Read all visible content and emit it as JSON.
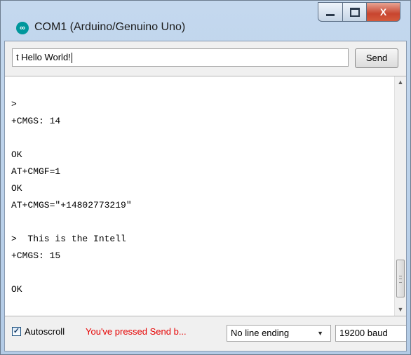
{
  "window": {
    "title": "COM1 (Arduino/Genuino Uno)",
    "app_icon": "arduino-logo-icon",
    "icon_glyph": "∞",
    "controls": [
      "minimize-icon",
      "maximize-icon",
      "close-icon"
    ],
    "close_glyph": "X"
  },
  "send_bar": {
    "input_value": "t Hello World!",
    "send_label": "Send"
  },
  "output": {
    "lines": [
      "",
      ">",
      "+CMGS: 14",
      "",
      "OK",
      "AT+CMGF=1",
      "OK",
      "AT+CMGS=\"+14802773219\"",
      "",
      ">  This is the Intell",
      "+CMGS: 15",
      "",
      "OK"
    ],
    "scroll_up": "▲",
    "scroll_down": "▼"
  },
  "status": {
    "autoscroll_checked": true,
    "check_glyph": "✓",
    "autoscroll_label": "Autoscroll",
    "warning": "You've pressed Send b...",
    "line_ending": "No line ending",
    "baud": "19200 baud",
    "dropdown_glyph": "▼"
  },
  "colors": {
    "warning_text": "#e60000",
    "title_bar": "#b9d0ea",
    "close_button": "#c8452f",
    "arduino_teal": "#00979c"
  }
}
